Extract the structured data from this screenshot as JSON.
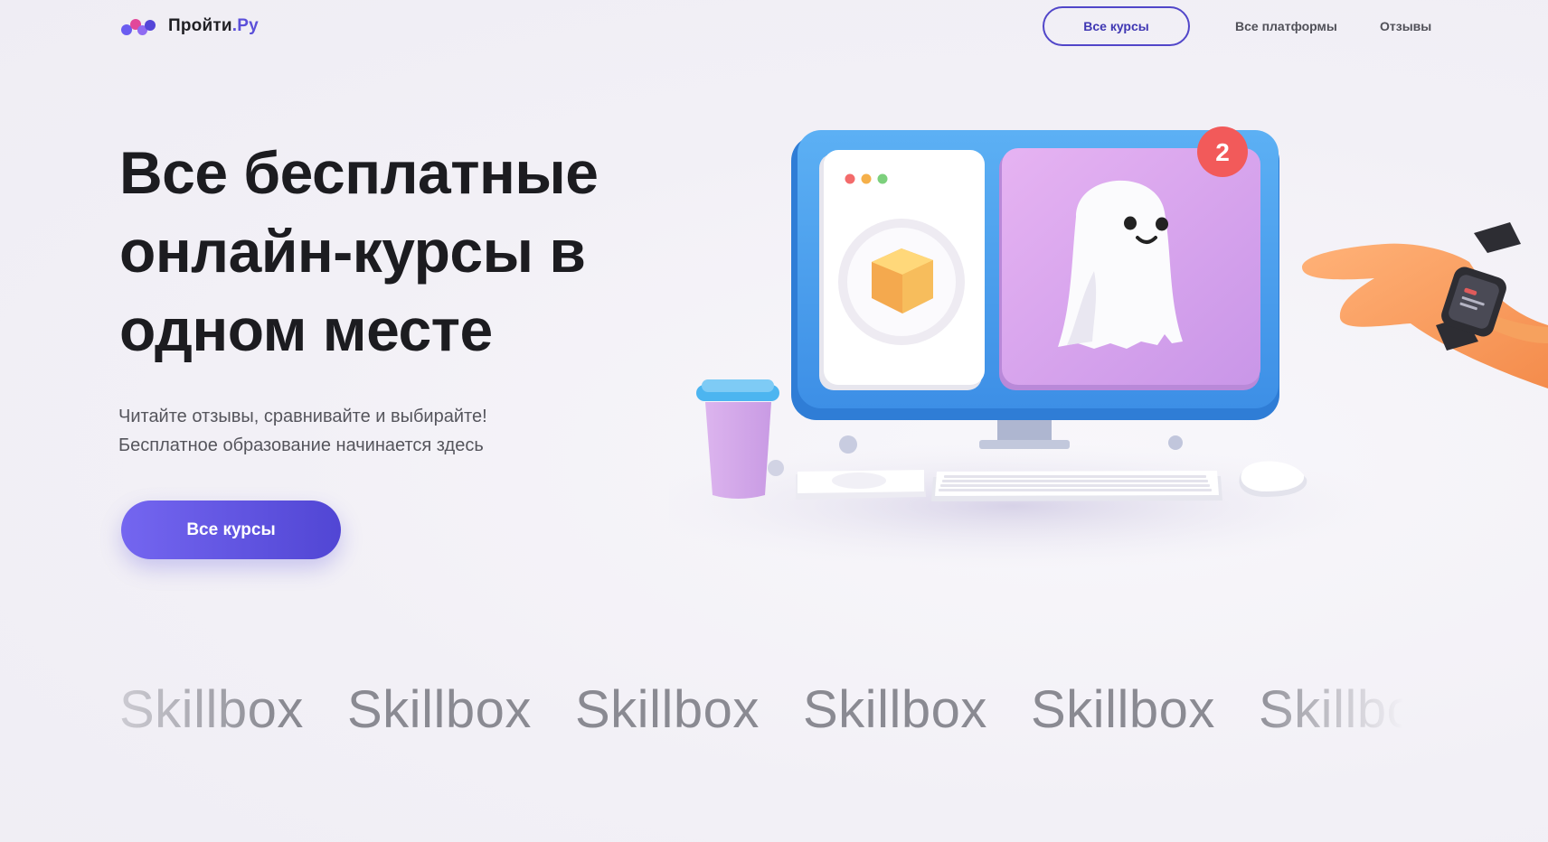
{
  "header": {
    "logo_text": "Пройти",
    "logo_domain": ".Ру",
    "nav_button": "Все курсы",
    "nav_links": [
      "Все платформы",
      "Отзывы"
    ]
  },
  "hero": {
    "title_lines": [
      "Все бесплатные",
      "онлайн-курсы в",
      "одном месте"
    ],
    "subtitle_lines": [
      "Читайте отзывы, сравнивайте и выбирайте!",
      "Бесплатное образование начинается здесь"
    ],
    "cta_label": "Все курсы",
    "notification_count": "2"
  },
  "brands": [
    "Skillbox",
    "Skillbox",
    "Skillbox",
    "Skillbox",
    "Skillbox",
    "Skillbox"
  ],
  "colors": {
    "accent": "#5b4fd9",
    "cta_start": "#7466f0",
    "cta_end": "#5146d4",
    "monitor": "#4fa3ee",
    "ghost_panel": "#d8a3ee",
    "badge": "#f25a5a"
  }
}
